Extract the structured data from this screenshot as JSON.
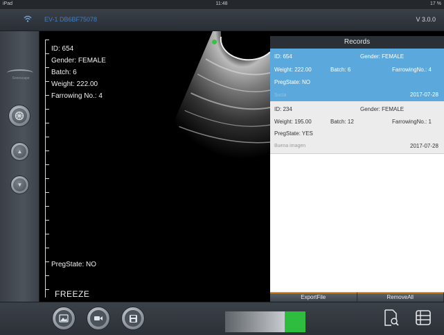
{
  "status_bar": {
    "carrier": "iPad",
    "time": "11:48",
    "battery": "17 %"
  },
  "header": {
    "device_id": "EV-1 DB6BF75078",
    "version": "V 3.0.0"
  },
  "sidebar": {
    "logo_text": "Sonoscape"
  },
  "image_overlay": {
    "id_text": "ID: 654",
    "gender_text": "Gender: FEMALE",
    "batch_text": "Batch: 6",
    "weight_text": "Weight: 222.00",
    "farrowing_text": "Farrowing No.: 4",
    "pregstate_text": "PregState: NO",
    "freeze_label": "FREEZE"
  },
  "records": {
    "title": "Records",
    "items": [
      {
        "id": "ID: 654",
        "gender": "Gender: FEMALE",
        "weight": "Weight: 222.00",
        "batch": "Batch: 6",
        "farrowing": "FarrowingNo.: 4",
        "pregstate": "PregState: NO",
        "note": "Sucia",
        "date": "2017-07-28",
        "selected": true
      },
      {
        "id": "ID: 234",
        "gender": "Gender: FEMALE",
        "weight": "Weight: 195.00",
        "batch": "Batch: 12",
        "farrowing": "FarrowingNo.: 1",
        "pregstate": "PregState: YES",
        "note": "Buena imagen",
        "date": "2017-07-28",
        "selected": false
      }
    ],
    "export_label": "ExportFile",
    "remove_label": "RemoveAll"
  },
  "gain_control": {
    "level_fraction": 0.74
  },
  "colors": {
    "selected_record": "#5ba9dc",
    "accent_green": "#2fbd3f",
    "action_border": "#d98b2b",
    "device_id_blue": "#3c7fc2"
  },
  "icons": [
    "wifi-icon",
    "transducer-icon",
    "up-arrow-icon",
    "down-arrow-icon",
    "image-icon",
    "video-icon",
    "save-icon",
    "search-file-icon",
    "list-icon"
  ]
}
